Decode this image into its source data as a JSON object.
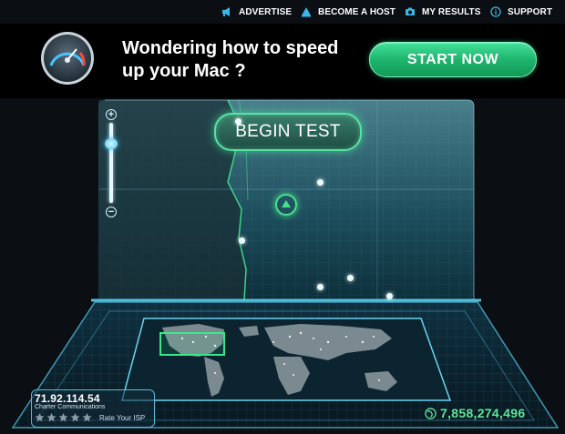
{
  "nav": {
    "advertise": "ADVERTISE",
    "become_host": "BECOME A HOST",
    "my_results": "MY RESULTS",
    "support": "SUPPORT"
  },
  "ad": {
    "headline": "Wondering how to speed up your Mac ?",
    "cta": "START NOW",
    "icon": "speedometer-icon"
  },
  "test": {
    "begin_label": "BEGIN TEST",
    "zoom_plus": "+",
    "zoom_minus": "−"
  },
  "isp": {
    "ip_address": "71.92.114.54",
    "provider": "Charter Communications",
    "rate_label": "Rate Your ISP",
    "rating": 0,
    "max_rating": 5
  },
  "counter": {
    "tests_total": "7,858,274,496",
    "icon": "globe-icon"
  },
  "colors": {
    "accent_green": "#48e08c",
    "glow_blue": "#5ad0f0",
    "nav_icon_blue": "#3cb8e6",
    "counter_green": "#5fe59a"
  }
}
